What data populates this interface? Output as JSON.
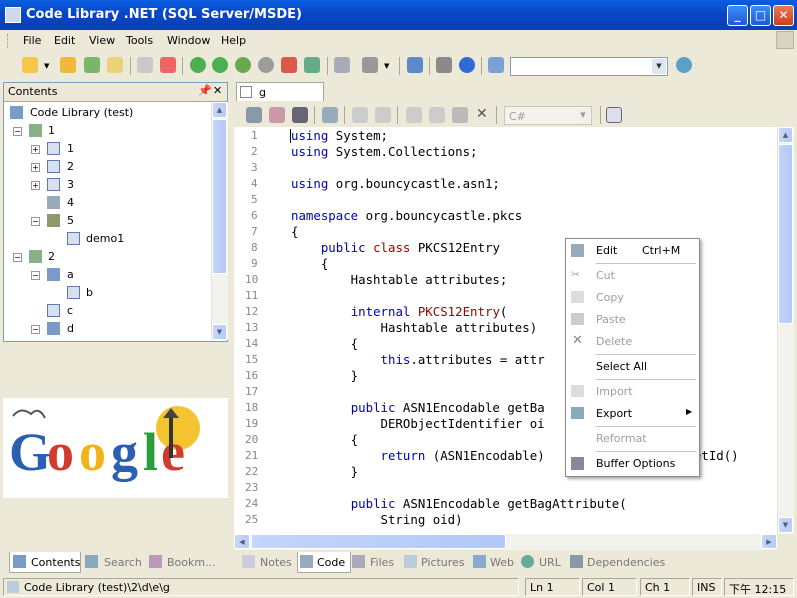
{
  "window": {
    "title": "Code Library .NET (SQL Server/MSDE)"
  },
  "menu": {
    "file": "File",
    "edit": "Edit",
    "view": "View",
    "tools": "Tools",
    "window": "Window",
    "help": "Help"
  },
  "contents_panel": {
    "title": "Contents",
    "tree": [
      {
        "label": "Code Library (test)"
      },
      {
        "label": "1"
      },
      {
        "label": "1"
      },
      {
        "label": "2"
      },
      {
        "label": "3"
      },
      {
        "label": "4"
      },
      {
        "label": "5"
      },
      {
        "label": "demo1"
      },
      {
        "label": "2"
      },
      {
        "label": "a"
      },
      {
        "label": "b"
      },
      {
        "label": "c"
      },
      {
        "label": "d"
      }
    ]
  },
  "logo": {
    "text": "Google"
  },
  "left_tabs": {
    "contents": "Contents",
    "search": "Search",
    "bookmarks": "Bookm..."
  },
  "document": {
    "tab_title": "g",
    "language": "C#"
  },
  "code": {
    "line_numbers": [
      "1",
      "2",
      "3",
      "4",
      "5",
      "6",
      "7",
      "8",
      "9",
      "10",
      "11",
      "12",
      "13",
      "14",
      "15",
      "16",
      "17",
      "18",
      "19",
      "20",
      "21",
      "22",
      "23",
      "24",
      "25"
    ],
    "lines": [
      {
        "n": "1"
      },
      {
        "n": "2"
      }
    ]
  },
  "context_menu": {
    "edit": "Edit",
    "edit_shortcut": "Ctrl+M",
    "cut": "Cut",
    "copy": "Copy",
    "paste": "Paste",
    "delete": "Delete",
    "select_all": "Select All",
    "import": "Import",
    "export": "Export",
    "reformat": "Reformat",
    "buffer_options": "Buffer Options"
  },
  "bottom_tabs": {
    "notes": "Notes",
    "code": "Code",
    "files": "Files",
    "pictures": "Pictures",
    "web": "Web",
    "url": "URL",
    "dependencies": "Dependencies"
  },
  "status": {
    "path": "Code Library (test)\\2\\d\\e\\g",
    "ln": "Ln 1",
    "col": "Col 1",
    "ch": "Ch 1",
    "ins": "INS",
    "time": "下午 12:15"
  }
}
